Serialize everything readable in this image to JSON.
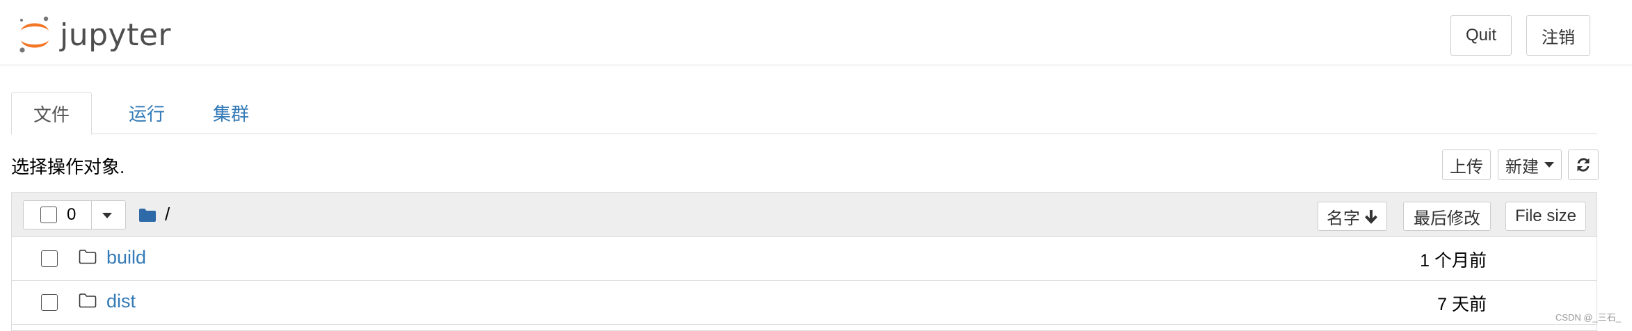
{
  "app": {
    "name": "jupyter"
  },
  "header": {
    "quit_label": "Quit",
    "logout_label": "注销"
  },
  "tabs": [
    {
      "label": "文件",
      "active": true
    },
    {
      "label": "运行",
      "active": false
    },
    {
      "label": "集群",
      "active": false
    }
  ],
  "toolbar": {
    "select_hint": "选择操作对象.",
    "upload_label": "上传",
    "new_label": "新建",
    "refresh_icon": "refresh-icon"
  },
  "list_header": {
    "selected_count": "0",
    "path": "/",
    "sort_name_label": "名字",
    "sort_modified_label": "最后修改",
    "sort_size_label": "File size"
  },
  "files": [
    {
      "name": "build",
      "modified": "1 个月前",
      "icon": "folder-icon"
    },
    {
      "name": "dist",
      "modified": "7 天前",
      "icon": "folder-icon"
    }
  ],
  "watermark": "CSDN @_三石_",
  "colors": {
    "link": "#337ab7",
    "logo_orange": "#F37726",
    "logo_grey": "#767677"
  }
}
